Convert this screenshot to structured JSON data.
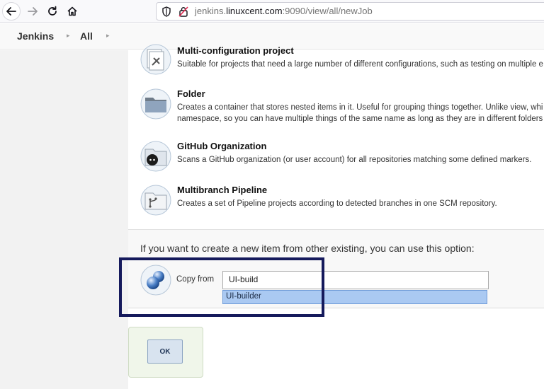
{
  "browser": {
    "url_prefix": "jenkins.",
    "url_host": "linuxcent.com",
    "url_suffix": ":9090/view/all/newJob"
  },
  "breadcrumb": {
    "items": [
      {
        "label": "Jenkins"
      },
      {
        "label": "All"
      }
    ]
  },
  "job_types": [
    {
      "title": "Multi-configuration project",
      "desc_lines": [
        "Suitable for projects that need a large number of different configurations, such as testing on multiple e"
      ],
      "icon": "multi-config-icon"
    },
    {
      "title": "Folder",
      "desc_lines": [
        "Creates a container that stores nested items in it. Useful for grouping things together. Unlike view, whi",
        "namespace, so you can have multiple things of the same name as long as they are in different folders"
      ],
      "icon": "folder-icon"
    },
    {
      "title": "GitHub Organization",
      "desc_lines": [
        "Scans a GitHub organization (or user account) for all repositories matching some defined markers."
      ],
      "icon": "github-icon"
    },
    {
      "title": "Multibranch Pipeline",
      "desc_lines": [
        "Creates a set of Pipeline projects according to detected branches in one SCM repository."
      ],
      "icon": "multibranch-icon"
    }
  ],
  "copy_section": {
    "heading": "If you want to create a new item from other existing, you can use this option:",
    "label": "Copy from",
    "input_value": "UI-build",
    "suggestion": "UI-builder"
  },
  "ok_button": {
    "label": "OK"
  },
  "colors": {
    "highlight_border": "#151a5c",
    "suggestion_bg": "#aac9f2"
  }
}
